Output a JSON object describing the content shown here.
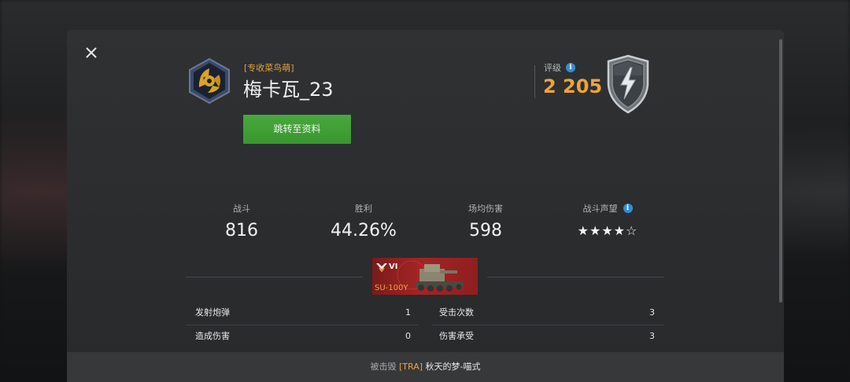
{
  "player": {
    "clan_tag": "[专收菜鸟萌]",
    "name": "梅卡瓦_23",
    "profile_button": "跳转至资料"
  },
  "rating": {
    "label": "评级",
    "value": "2 205",
    "info_icon": "info-icon",
    "badge_icon": "lightning-shield-icon"
  },
  "stats": {
    "battles": {
      "label": "战斗",
      "value": "816"
    },
    "wins": {
      "label": "胜利",
      "value": "44.26%"
    },
    "avg_damage": {
      "label": "场均伤害",
      "value": "598"
    },
    "reputation": {
      "label": "战斗声望",
      "stars": "★★★★☆",
      "stars_filled": 4,
      "stars_total": 5
    }
  },
  "tank": {
    "tier": "VI",
    "name": "SU-100Y"
  },
  "details": [
    {
      "label": "发射炮弹",
      "value": "1"
    },
    {
      "label": "受击次数",
      "value": "3"
    },
    {
      "label": "造成伤害",
      "value": "0"
    },
    {
      "label": "伤害承受",
      "value": "3"
    }
  ],
  "footer": {
    "prefix": "被击毁",
    "clan_tag": "[TRA]",
    "killer_name": "秋天的梦-喵式"
  },
  "colors": {
    "accent_orange": "#f0a33b",
    "button_green": "#45a63a",
    "info_blue": "#2f8fd6",
    "tank_card_red": "#a52424"
  }
}
